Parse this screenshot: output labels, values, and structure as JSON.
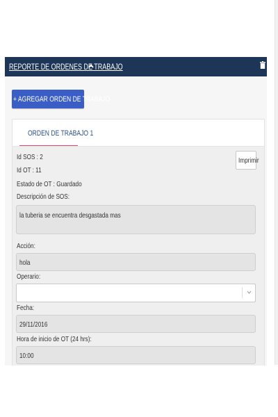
{
  "panel": {
    "title": "REPORTE DE ORDENES DE TRABAJO",
    "caret_icon": "chevron-up-icon",
    "delete_icon": "trash-icon"
  },
  "toolbar": {
    "add_label": "+ AGREGAR ORDEN DE TRABAJO"
  },
  "tabs": [
    {
      "label": "ORDEN DE TRABAJO 1",
      "active": true
    }
  ],
  "order": {
    "print_label": "Imprimir",
    "id_sos": "Id SOS : 2",
    "id_ot": "Id OT : 11",
    "estado_label": "Estado de OT :",
    "estado_value": "Guardado",
    "descripcion_label": "Descripción de SOS:",
    "descripcion_value": "la tuberia se encuentra desgastada mas",
    "accion_label": "Acción:",
    "accion_value": "hola",
    "operario_label": "Operario:",
    "operario_value": "",
    "fecha_label": "Fecha:",
    "fecha_value": "29/11/2016",
    "hora_label": "Hora de inicio de OT (24 hrs):",
    "hora_value": "10:00"
  },
  "colors": {
    "header": "#1d3657",
    "primary_button": "#3b5ec6",
    "tab_underline": "#e8406e",
    "tab_text": "#2c4f8b"
  }
}
